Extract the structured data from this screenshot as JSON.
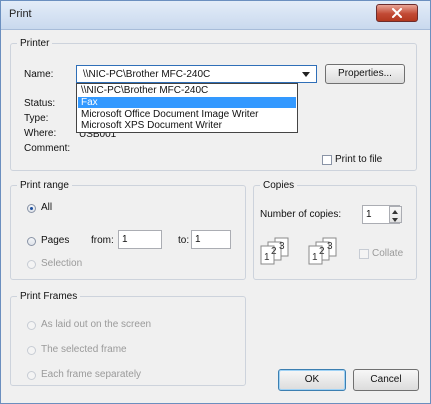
{
  "window": {
    "title": "Print"
  },
  "printer": {
    "legend": "Printer",
    "name_label": "Name:",
    "selected": "\\\\NIC-PC\\Brother MFC-240C",
    "properties_label": "Properties...",
    "status_label": "Status:",
    "type_label": "Type:",
    "where_label": "Where:",
    "where_value": "USB001",
    "comment_label": "Comment:",
    "print_to_file": "Print to file",
    "options": [
      "\\\\NIC-PC\\Brother MFC-240C",
      "Fax",
      "Microsoft Office Document Image Writer",
      "Microsoft XPS Document Writer"
    ],
    "highlighted_option": "Fax"
  },
  "print_range": {
    "legend": "Print range",
    "all": "All",
    "pages": "Pages",
    "from_label": "from:",
    "from_value": "1",
    "to_label": "to:",
    "to_value": "1",
    "selection": "Selection"
  },
  "copies": {
    "legend": "Copies",
    "number_label": "Number of copies:",
    "number_value": "1",
    "collate": "Collate",
    "stack1": [
      "1",
      "2",
      "3"
    ],
    "stack2": [
      "1",
      "2",
      "3"
    ]
  },
  "print_frames": {
    "legend": "Print Frames",
    "opt1": "As laid out on the screen",
    "opt2": "The selected frame",
    "opt3": "Each frame separately"
  },
  "buttons": {
    "ok": "OK",
    "cancel": "Cancel"
  },
  "colors": {
    "accent": "#3399ff",
    "close": "#c24a35"
  }
}
